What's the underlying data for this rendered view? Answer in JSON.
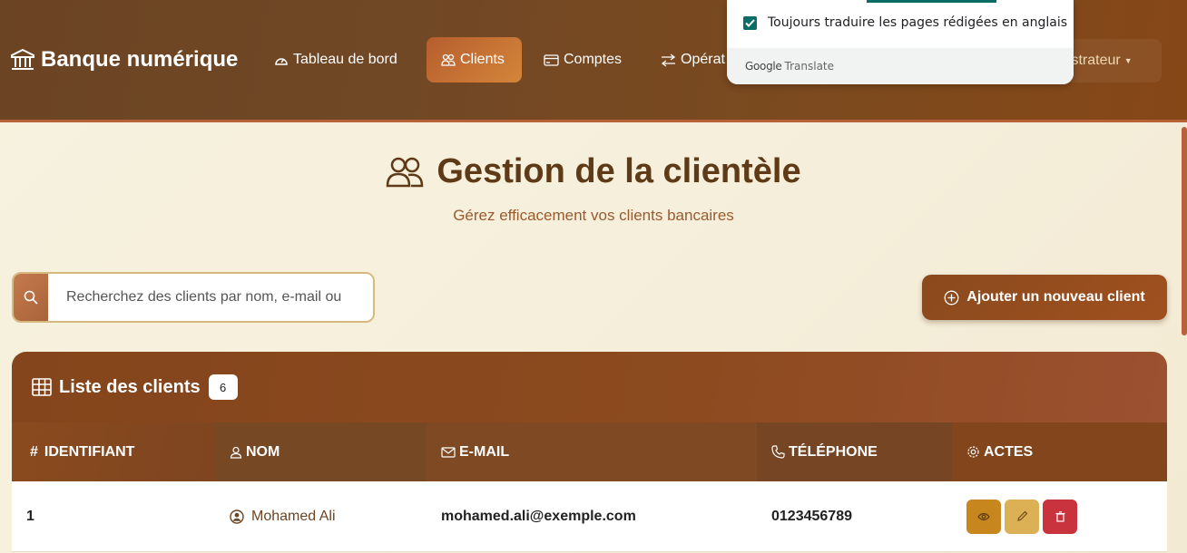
{
  "navbar": {
    "brand": "Banque numérique",
    "items": [
      {
        "label": "Tableau de bord",
        "icon": "speedometer-icon"
      },
      {
        "label": "Clients",
        "icon": "people-icon"
      },
      {
        "label": "Comptes",
        "icon": "credit-card-icon"
      },
      {
        "label": "Opérat",
        "icon": "swap-arrows-icon"
      }
    ],
    "admin_label": "nistrateur"
  },
  "translate_popup": {
    "checkbox_label": "Toujours traduire les pages rédigées en anglais",
    "checked": true,
    "footer_google": "Google",
    "footer_translate": "Translate"
  },
  "page": {
    "title": "Gestion de la clientèle",
    "subtitle": "Gérez efficacement vos clients bancaires"
  },
  "search": {
    "placeholder": "Recherchez des clients par nom, e-mail ou"
  },
  "add_button": "Ajouter un nouveau client",
  "clients_card": {
    "title": "Liste des clients",
    "count": "6",
    "columns": [
      "IDENTIFIANT",
      "NOM",
      "E-MAIL",
      "TÉLÉPHONE",
      "ACTES"
    ],
    "rows": [
      {
        "id": "1",
        "name": "Mohamed Ali",
        "email": "mohamed.ali@exemple.com",
        "phone": "0123456789"
      }
    ]
  },
  "colors": {
    "navbar": "#714825",
    "accent": "#b65e2e",
    "view_button": "#c8861e",
    "edit_button": "#dcb055",
    "delete_button": "#c8333e"
  }
}
